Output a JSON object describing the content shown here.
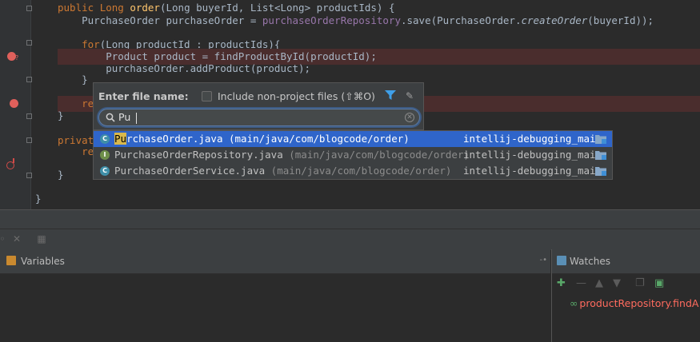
{
  "editor": {
    "lines": [
      {
        "segments": [
          {
            "t": "public ",
            "c": "kw"
          },
          {
            "t": "Long ",
            "c": "kw"
          },
          {
            "t": "order",
            "c": "fn"
          },
          {
            "t": "(Long buyerId, List<Long> productIds) {",
            "c": "dim"
          }
        ]
      },
      {
        "segments": [
          {
            "t": "    PurchaseOrder purchaseOrder = ",
            "c": "dim"
          },
          {
            "t": "purchaseOrderRepository",
            "c": "fld"
          },
          {
            "t": ".save(PurchaseOrder.",
            "c": "dim"
          },
          {
            "t": "createOrder",
            "c": "it"
          },
          {
            "t": "(buyerId));",
            "c": "dim"
          }
        ]
      },
      {
        "segments": [
          {
            "t": "",
            "c": "dim"
          }
        ]
      },
      {
        "segments": [
          {
            "t": "    ",
            "c": "dim"
          },
          {
            "t": "for",
            "c": "kw"
          },
          {
            "t": "(Long productId : productIds){",
            "c": "dim"
          }
        ]
      },
      {
        "segments": [
          {
            "t": "        Product product = findProductById(productId);",
            "c": "dim"
          }
        ]
      },
      {
        "segments": [
          {
            "t": "        purchaseOrder.addProduct(product);",
            "c": "dim"
          }
        ]
      },
      {
        "segments": [
          {
            "t": "    }",
            "c": "dim"
          }
        ]
      },
      {
        "segments": [
          {
            "t": "    ",
            "c": "dim"
          },
          {
            "t": "ret",
            "c": "kw"
          }
        ]
      },
      {
        "segments": [
          {
            "t": "}",
            "c": "dim"
          }
        ]
      },
      {
        "segments": [
          {
            "t": "",
            "c": "dim"
          }
        ]
      },
      {
        "segments": [
          {
            "t": "private",
            "c": "kw"
          }
        ]
      },
      {
        "segments": [
          {
            "t": "    ",
            "c": "dim"
          },
          {
            "t": "ret",
            "c": "kw"
          }
        ]
      },
      {
        "segments": [
          {
            "t": "}",
            "c": "dim"
          }
        ]
      },
      {
        "segments": [
          {
            "t": "",
            "c": "dim"
          }
        ]
      },
      {
        "segments": [
          {
            "t": "}",
            "c": "dim"
          }
        ]
      }
    ]
  },
  "popup": {
    "label": "Enter file name:",
    "checkbox_label": "Include non-project files (⇧⌘O)",
    "search_value": "Pu",
    "filter_icon": "filter-icon",
    "pin_icon": "pin-icon"
  },
  "results": [
    {
      "icon": "C",
      "match": "Pu",
      "name_rest": "rchaseOrder.java",
      "path": " (main/java/com/blogcode/order)",
      "module": "intellij-debugging_main",
      "selected": true
    },
    {
      "icon": "I",
      "match": "",
      "name_rest": "PurchaseOrderRepository.java",
      "path": " (main/java/com/blogcode/order)",
      "module": "intellij-debugging_main",
      "selected": false
    },
    {
      "icon": "C",
      "match": "",
      "name_rest": "PurchaseOrderService.java",
      "path": " (main/java/com/blogcode/order)",
      "module": "intellij-debugging_main",
      "selected": false
    }
  ],
  "panels": {
    "variables_title": "Variables",
    "watches_title": "Watches",
    "watch_item": "productRepository.findA"
  },
  "colors": {
    "selection": "#2f65ca",
    "breakpoint": "#e0605b",
    "keyword": "#cc7832"
  }
}
